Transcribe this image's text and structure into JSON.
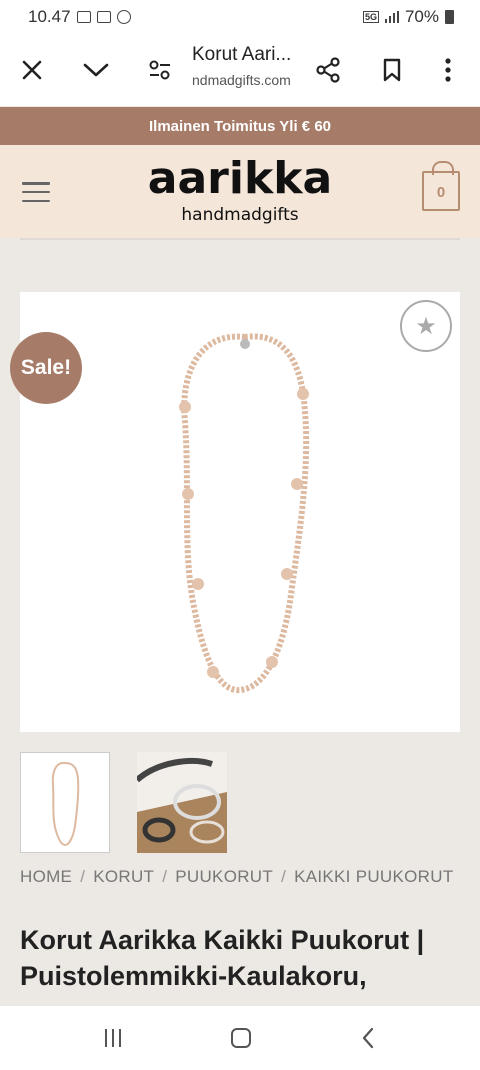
{
  "status_bar": {
    "time": "10.47",
    "battery": "70%",
    "network": "5G"
  },
  "browser": {
    "title": "Korut Aari...",
    "domain": "ndmadgifts.com"
  },
  "promo": {
    "text": "Ilmainen Toimitus Yli € 60"
  },
  "header": {
    "logo_main": "aarikka",
    "logo_sub": "handmadgifts",
    "cart_count": "0"
  },
  "product": {
    "sale_label": "Sale!",
    "title": "Korut Aarikka Kaikki Puukorut | Puistolemmikki-Kaulakoru,"
  },
  "breadcrumbs": [
    "HOME",
    "KORUT",
    "PUUKORUT",
    "KAIKKI PUUKORUT"
  ],
  "colors": {
    "accent": "#a67c68",
    "header_bg": "#f5e6da",
    "cart": "#b78d72",
    "page_bg": "#ece8e3"
  }
}
